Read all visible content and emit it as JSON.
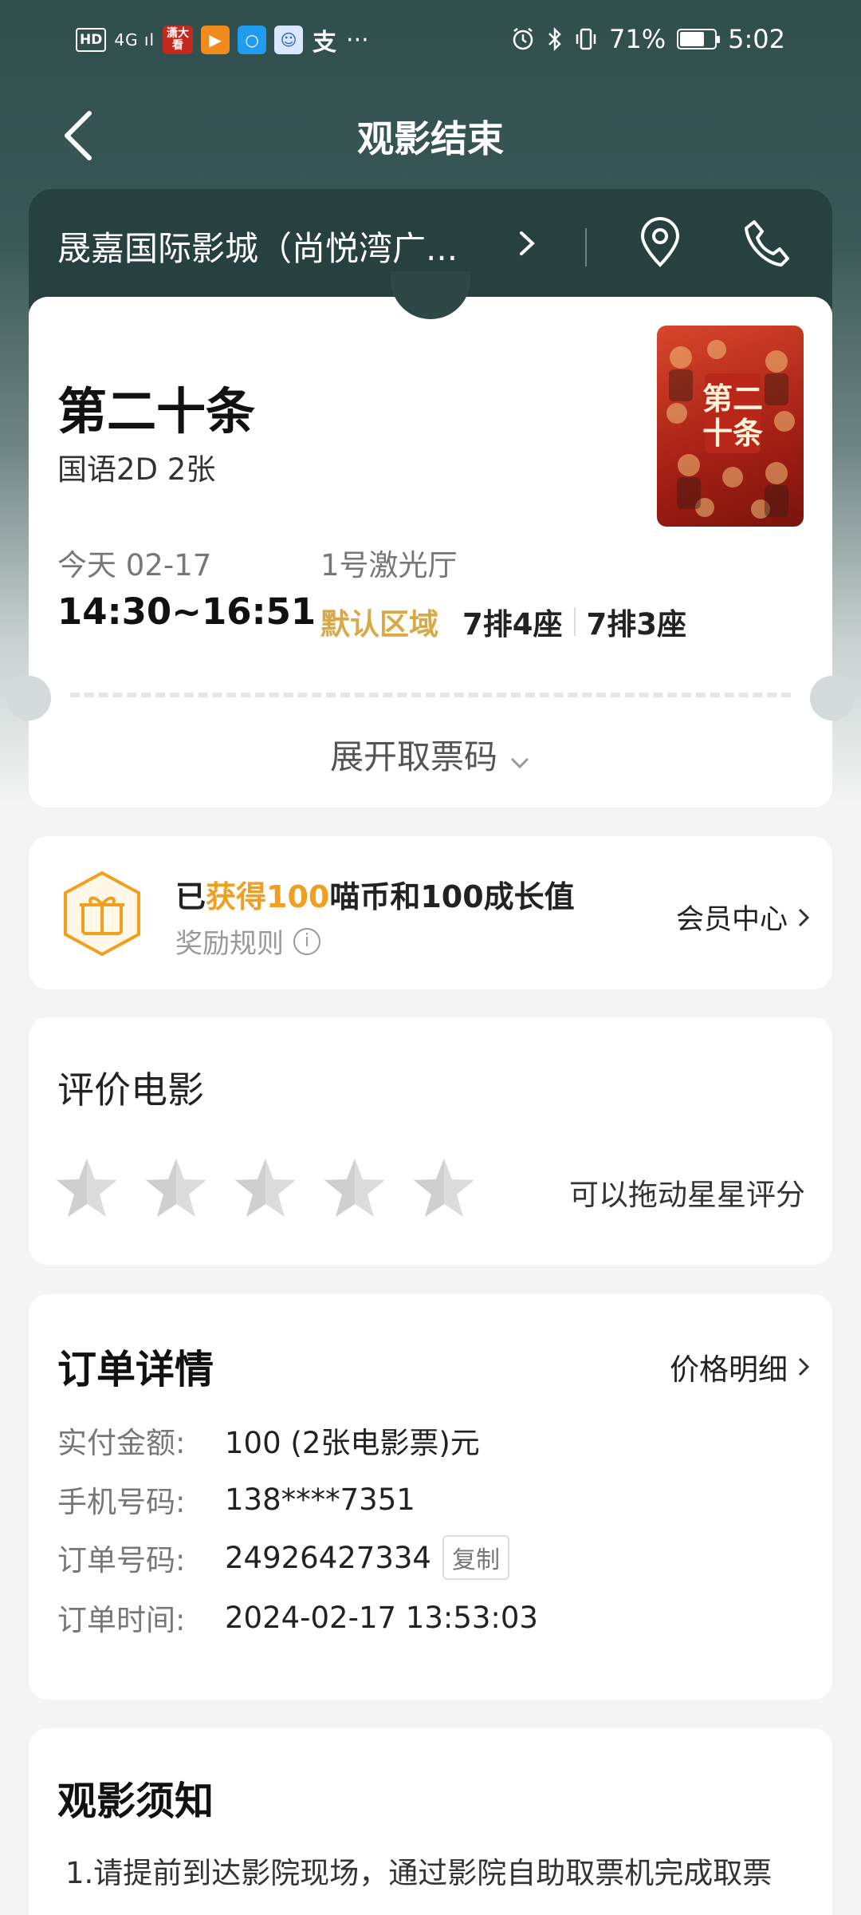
{
  "status_bar": {
    "hd": "HD",
    "signal": "4G ıl",
    "app1": "潇大看",
    "more": "···",
    "battery_percent": "71%",
    "time": "5:02",
    "battery_level": 0.71
  },
  "header": {
    "title": "观影结束"
  },
  "cinema": {
    "name": "晟嘉国际影城（尚悦湾广..."
  },
  "ticket": {
    "movie_title": "第二十条",
    "spec": "国语2D 2张",
    "date": "今天 02-17",
    "time": "14:30~16:51",
    "hall": "1号激光厅",
    "area": "默认区域",
    "seats": [
      "7排4座",
      "7排3座"
    ],
    "expand_label": "展开取票码"
  },
  "reward": {
    "prefix": "已",
    "highlight": "获得100",
    "suffix": "喵币和100成长值",
    "rule": "奖励规则",
    "member_link": "会员中心"
  },
  "rating": {
    "title": "评价电影",
    "hint": "可以拖动星星评分",
    "stars_total": 5,
    "stars_selected": 0
  },
  "order": {
    "title": "订单详情",
    "price_link": "价格明细",
    "rows": [
      {
        "label": "实付金额:",
        "value": "100 (2张电影票)元"
      },
      {
        "label": "手机号码:",
        "value": "138****7351"
      },
      {
        "label": "订单号码:",
        "value": "24926427334"
      },
      {
        "label": "订单时间:",
        "value": "2024-02-17 13:53:03"
      }
    ],
    "copy_label": "复制"
  },
  "notice": {
    "title": "观影须知",
    "text": "1.请提前到达影院现场，通过影院自助取票机完成取票"
  },
  "colors": {
    "header_bg": "#2f4e4c",
    "accent_gold": "#d8a948",
    "accent_orange": "#f0a020"
  }
}
